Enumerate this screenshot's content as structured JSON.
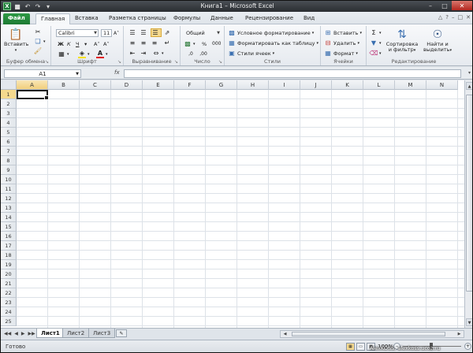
{
  "window": {
    "title": "Книга1 – Microsoft Excel"
  },
  "quick_access": {
    "icons": [
      "excel-logo-icon",
      "save-icon",
      "undo-icon",
      "redo-icon",
      "customize-icon"
    ]
  },
  "tabs": [
    "Файл",
    "Главная",
    "Вставка",
    "Разметка страницы",
    "Формулы",
    "Данные",
    "Рецензирование",
    "Вид"
  ],
  "ribbon": {
    "clipboard": {
      "label": "Буфер обмена",
      "paste": "Вставить"
    },
    "font": {
      "label": "Шрифт",
      "font_name": "Calibri",
      "font_size": "11",
      "bold": "Ж",
      "italic": "К",
      "underline": "Ч"
    },
    "alignment": {
      "label": "Выравнивание"
    },
    "number": {
      "label": "Число",
      "format": "Общий",
      "percent": "%",
      "thousands": "000"
    },
    "styles": {
      "label": "Стили",
      "conditional": "Условное форматирование",
      "format_table": "Форматировать как таблицу",
      "cell_styles": "Стили ячеек"
    },
    "cells": {
      "label": "Ячейки",
      "insert": "Вставить",
      "delete": "Удалить",
      "format": "Формат"
    },
    "editing": {
      "label": "Редактирование",
      "sort_1": "Сортировка",
      "sort_2": "и фильтр",
      "find_1": "Найти и",
      "find_2": "выделить"
    }
  },
  "formula_bar": {
    "name_box": "A1",
    "fx": "fx",
    "formula": ""
  },
  "columns": [
    "A",
    "B",
    "C",
    "D",
    "E",
    "F",
    "G",
    "H",
    "I",
    "J",
    "K",
    "L",
    "M",
    "N"
  ],
  "rows": [
    "1",
    "2",
    "3",
    "4",
    "5",
    "6",
    "7",
    "8",
    "9",
    "10",
    "11",
    "12",
    "13",
    "14",
    "15",
    "16",
    "17",
    "18",
    "19",
    "20",
    "21",
    "22",
    "23",
    "24",
    "25"
  ],
  "sheets": [
    "Лист1",
    "Лист2",
    "Лист3"
  ],
  "status": {
    "text": "Готово",
    "zoom": "100%"
  },
  "watermark": "AlexKOSS, alexkoss.ucoz.ru",
  "colors": {
    "file_tab": "#1d7a33",
    "selection_header": "#f5d98e",
    "grid_line": "#dde2e8"
  }
}
